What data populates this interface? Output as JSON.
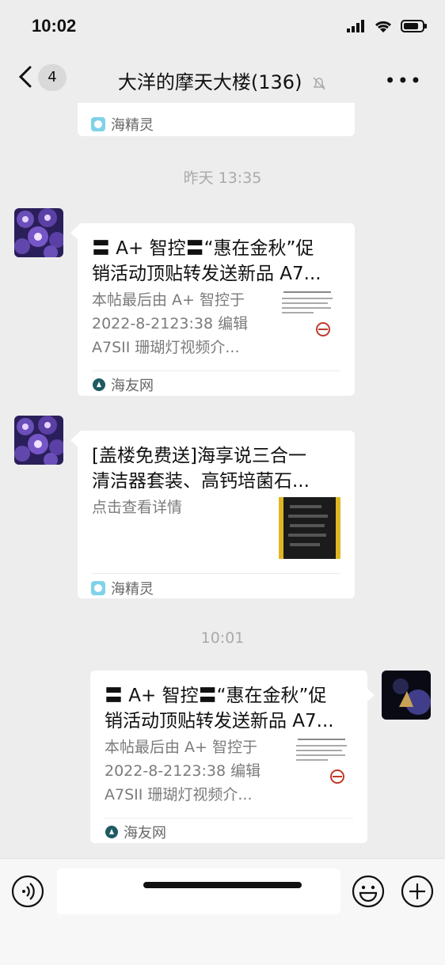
{
  "status_bar": {
    "time": "10:02"
  },
  "nav": {
    "back_count": "4",
    "title": "大洋的摩天大楼(136)"
  },
  "top_card": {
    "source": "海精灵"
  },
  "timestamps": {
    "yesterday": "昨天 13:35",
    "now": "10:01"
  },
  "messages": [
    {
      "side": "left",
      "title": "〓 A+ 智控〓“惠在金秋”促销活动顶贴转发送新品 A7...",
      "title_line1": "〓 A+ 智控〓“惠在金秋”促",
      "title_line2": "销活动顶贴转发送新品 A7...",
      "desc_line1": "本帖最后由 A+ 智控于",
      "desc_line2": "2022-8-2123:38 编辑",
      "desc_line3": "A7SII 珊瑚灯视频介...",
      "source": "海友网"
    },
    {
      "side": "left",
      "title_line1": "[盖楼免费送]海享说三合一",
      "title_line2": "清洁器套装、高钙培菌石...",
      "desc_line1": "点击查看详情",
      "source": "海精灵"
    },
    {
      "side": "right",
      "title_line1": "〓 A+ 智控〓“惠在金秋”促",
      "title_line2": "销活动顶贴转发送新品 A7...",
      "desc_line1": "本帖最后由 A+ 智控于",
      "desc_line2": "2022-8-2123:38 编辑",
      "desc_line3": "A7SII 珊瑚灯视频介...",
      "source": "海友网"
    }
  ],
  "colors": {
    "background": "#ededed",
    "card": "#ffffff",
    "muted": "#7b7b7b"
  }
}
